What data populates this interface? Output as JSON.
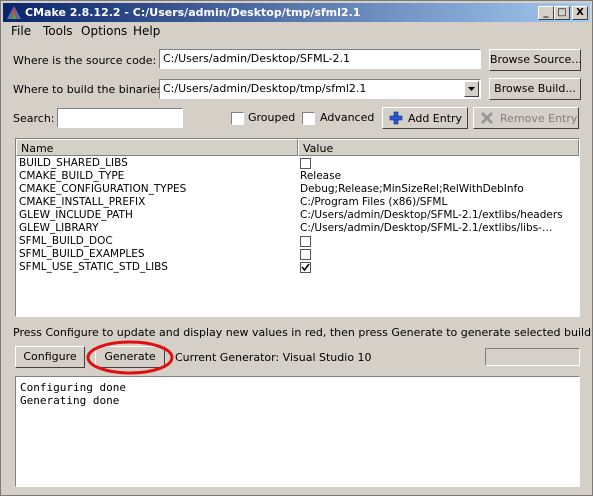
{
  "window": {
    "title": "CMake 2.8.12.2 - C:/Users/admin/Desktop/tmp/sfml2.1",
    "minimize": "_",
    "maximize": "□",
    "close": "X"
  },
  "menu": [
    {
      "label": "File"
    },
    {
      "label": "Tools"
    },
    {
      "label": "Options"
    },
    {
      "label": "Help"
    }
  ],
  "source": {
    "label": "Where is the source code:",
    "value": "C:/Users/admin/Desktop/SFML-2.1",
    "browse": "Browse Source..."
  },
  "build": {
    "label": "Where to build the binaries:",
    "value": "C:/Users/admin/Desktop/tmp/sfml2.1",
    "browse": "Browse Build..."
  },
  "search": {
    "label": "Search:",
    "value": "",
    "grouped_label": "Grouped",
    "grouped": false,
    "advanced_label": "Advanced",
    "advanced": false,
    "add_entry": "Add Entry",
    "remove_entry": "Remove Entry"
  },
  "table": {
    "col_name": "Name",
    "col_value": "Value",
    "rows": [
      {
        "name": "BUILD_SHARED_LIBS",
        "value": "",
        "checkbox": true,
        "checked": false
      },
      {
        "name": "CMAKE_BUILD_TYPE",
        "value": "Release",
        "checkbox": false
      },
      {
        "name": "CMAKE_CONFIGURATION_TYPES",
        "value": "Debug;Release;MinSizeRel;RelWithDebInfo",
        "checkbox": false
      },
      {
        "name": "CMAKE_INSTALL_PREFIX",
        "value": "C:/Program Files (x86)/SFML",
        "checkbox": false
      },
      {
        "name": "GLEW_INCLUDE_PATH",
        "value": "C:/Users/admin/Desktop/SFML-2.1/extlibs/headers",
        "checkbox": false
      },
      {
        "name": "GLEW_LIBRARY",
        "value": "C:/Users/admin/Desktop/SFML-2.1/extlibs/libs-…",
        "checkbox": false
      },
      {
        "name": "SFML_BUILD_DOC",
        "value": "",
        "checkbox": true,
        "checked": false
      },
      {
        "name": "SFML_BUILD_EXAMPLES",
        "value": "",
        "checkbox": true,
        "checked": false
      },
      {
        "name": "SFML_USE_STATIC_STD_LIBS",
        "value": "",
        "checkbox": true,
        "checked": true
      }
    ]
  },
  "hint": "Press Configure to update and display new values in red, then press Generate to generate selected build files.",
  "actions": {
    "configure": "Configure",
    "generate": "Generate",
    "generator": "Current Generator: Visual Studio 10",
    "progress": 0
  },
  "output": {
    "lines": [
      "Configuring done",
      "Generating done"
    ]
  },
  "colors": {
    "highlight_circle": "#e01010",
    "title_bar": "#0a246a"
  },
  "icons": {
    "app": "cmake-triangle-icon",
    "add": "plus-icon",
    "remove": "x-icon",
    "dropdown": "chevron-down-icon"
  }
}
